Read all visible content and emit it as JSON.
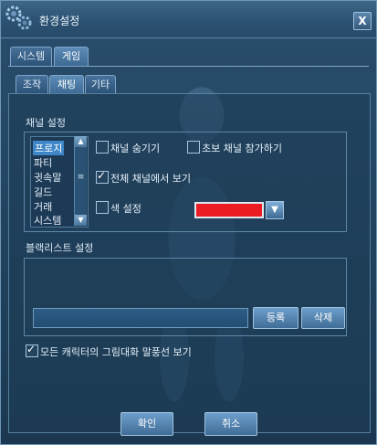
{
  "window": {
    "title": "환경설정",
    "close": "X"
  },
  "tabs_main": [
    {
      "label": "시스템",
      "active": false
    },
    {
      "label": "게임",
      "active": true
    }
  ],
  "tabs_sub": [
    {
      "label": "조작",
      "active": false
    },
    {
      "label": "채팅",
      "active": true
    },
    {
      "label": "기타",
      "active": false
    }
  ],
  "channel": {
    "heading": "채널 설정",
    "items": [
      "프로지",
      "파티",
      "귓속말",
      "길드",
      "거래",
      "시스템"
    ],
    "selected_index": 0,
    "options": [
      {
        "label": "채널 숨기기",
        "checked": false
      },
      {
        "label": "초보 채널 참가하기",
        "checked": false
      },
      {
        "label": "전체 채널에서 보기",
        "checked": true
      },
      {
        "label": "색 설정",
        "checked": false
      }
    ],
    "color_value": "#ec1c24"
  },
  "blacklist": {
    "heading": "블랙리스트 설정",
    "input_value": "",
    "register": "등록",
    "delete": "삭제"
  },
  "bubble_option": {
    "label": "모든 캐릭터의 그림대화 말풍선 보기",
    "checked": true
  },
  "footer": {
    "ok": "확인",
    "cancel": "취소"
  },
  "icons": {
    "title": "gear-icon",
    "dropdown": "chevron-down-icon"
  }
}
